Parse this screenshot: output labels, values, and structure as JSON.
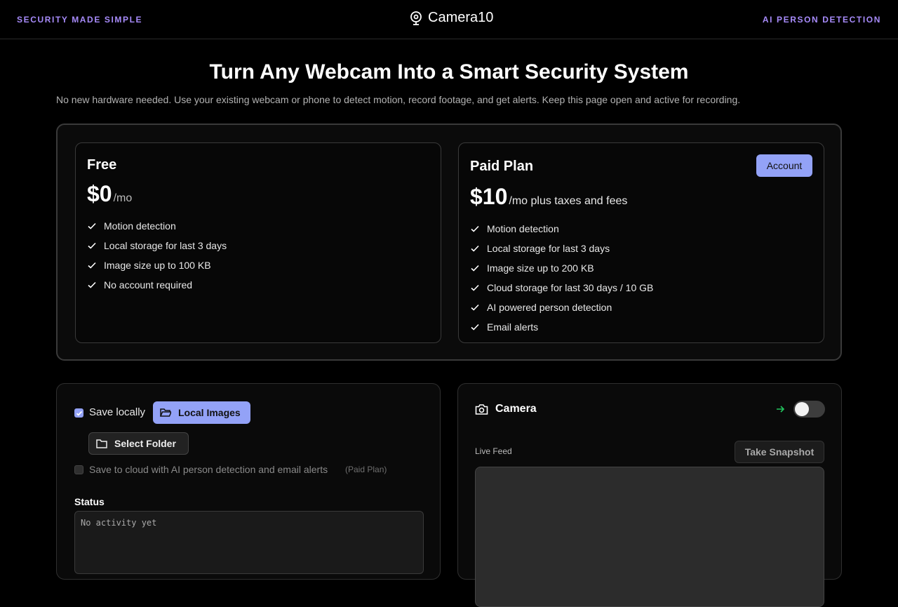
{
  "header": {
    "tagline_left": "SECURITY MADE SIMPLE",
    "brand": "Camera10",
    "tagline_right": "AI PERSON DETECTION"
  },
  "hero": {
    "title": "Turn Any Webcam Into a Smart Security System",
    "subtitle": "No new hardware needed. Use your existing webcam or phone to detect motion, record footage, and get alerts. Keep this page open and active for recording."
  },
  "plans": {
    "free": {
      "name": "Free",
      "price": "$0",
      "period": "/mo",
      "features": [
        "Motion detection",
        "Local storage for last 3 days",
        "Image size up to 100 KB",
        "No account required"
      ]
    },
    "paid": {
      "name": "Paid Plan",
      "price": "$10",
      "period": "/mo plus taxes and fees",
      "account_button": "Account",
      "features": [
        "Motion detection",
        "Local storage for last 3 days",
        "Image size up to 200 KB",
        "Cloud storage for last 30 days / 10 GB",
        "AI powered person detection",
        "Email alerts"
      ]
    }
  },
  "storage": {
    "save_locally_label": "Save locally",
    "save_locally_checked": true,
    "local_images_button": "Local Images",
    "select_folder_button": "Select Folder",
    "save_cloud_label": "Save to cloud with AI person detection and email alerts",
    "save_cloud_note": "(Paid Plan)",
    "save_cloud_checked": false,
    "status_title": "Status",
    "status_text": "No activity yet"
  },
  "camera": {
    "title": "Camera",
    "enabled": false,
    "live_feed_label": "Live Feed",
    "snapshot_button": "Take Snapshot"
  },
  "colors": {
    "accent": "#93a2f7",
    "tagline": "#a78bfa",
    "arrow": "#22c55e"
  }
}
